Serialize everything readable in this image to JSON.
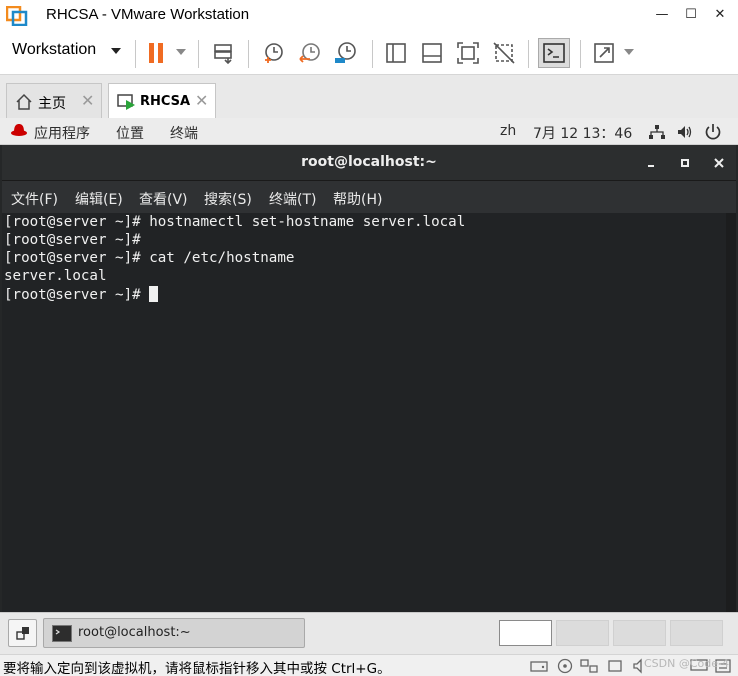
{
  "window": {
    "title": "RHCSA - VMware Workstation",
    "min": "—",
    "max": "☐",
    "close": "✕"
  },
  "toolbar": {
    "workstation_menu": "Workstation"
  },
  "tabs": [
    {
      "label": "主页",
      "icon": "home-icon",
      "close": "✕"
    },
    {
      "label": "RHCSA",
      "icon": "vm-running-icon",
      "close": "✕"
    }
  ],
  "gnome_top_bar": {
    "applications": "应用程序",
    "places": "位置",
    "terminal": "终端",
    "input_method": "zh",
    "clock": "7月 12  13：46"
  },
  "terminal": {
    "title": "root@localhost:~",
    "menu": [
      "文件(F)",
      "编辑(E)",
      "查看(V)",
      "搜索(S)",
      "终端(T)",
      "帮助(H)"
    ],
    "lines": [
      "[root@server ~]# hostnamectl set-hostname server.local",
      "[root@server ~]#",
      "[root@server ~]# cat /etc/hostname",
      "server.local",
      "[root@server ~]# "
    ]
  },
  "taskbar": {
    "task_label": "root@localhost:~"
  },
  "statusbar": {
    "message": "要将输入定向到该虚拟机，请将鼠标指针移入其中或按 Ctrl+G。",
    "watermark": "CSDN @Code-4"
  },
  "colors": {
    "pause_orange": "#f06b22",
    "terminal_bg": "#212325",
    "redhat_red": "#cc0000"
  }
}
